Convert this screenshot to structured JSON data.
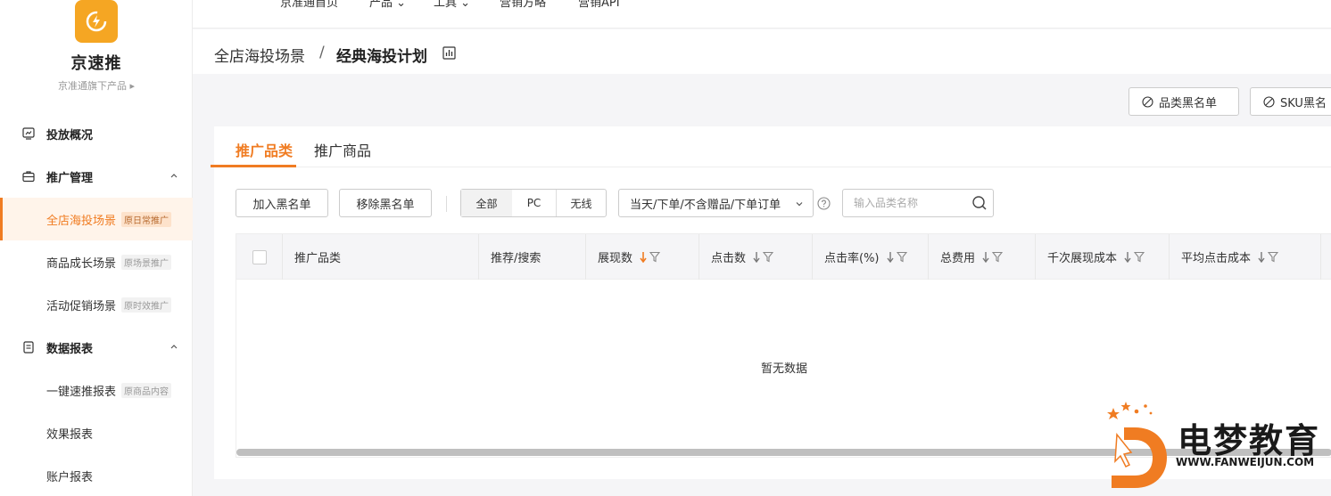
{
  "sidebar": {
    "brand": "京速推",
    "brand_sub": "京准通旗下产品 ▸",
    "groups": {
      "overview": "投放概况",
      "promo_mgmt": "推广管理",
      "reports": "数据报表"
    },
    "items": [
      {
        "label": "全店海投场景",
        "tag": "原日常推广"
      },
      {
        "label": "商品成长场景",
        "tag": "原场景推广"
      },
      {
        "label": "活动促销场景",
        "tag": "原时效推广"
      },
      {
        "label": "一键速推报表",
        "tag": "原商品内容"
      },
      {
        "label": "效果报表",
        "tag": ""
      },
      {
        "label": "账户报表",
        "tag": ""
      }
    ]
  },
  "topnav": [
    "京准通首页",
    "产品",
    "工具",
    "营销方略",
    "营销API"
  ],
  "breadcrumb": {
    "parent": "全店海投场景",
    "separator": "/",
    "current": "经典海投计划"
  },
  "actions": {
    "category_blacklist": "品类黑名单",
    "sku_blacklist": "SKU黑名"
  },
  "tabs": [
    "推广品类",
    "推广商品"
  ],
  "toolbar": {
    "add_blacklist": "加入黑名单",
    "remove_blacklist": "移除黑名单",
    "segments": [
      "全部",
      "PC",
      "无线"
    ],
    "date_select": "当天/下单/不含赠品/下单订单",
    "search_placeholder": "输入品类名称"
  },
  "table": {
    "columns": [
      "推广品类",
      "推荐/搜索",
      "展现数",
      "点击数",
      "点击率(%)",
      "总费用",
      "千次展现成本",
      "平均点击成本"
    ],
    "empty_text": "暂无数据"
  },
  "watermark": {
    "title": "电梦教育",
    "url": "WWW.FANWEIJUN.COM"
  },
  "colors": {
    "accent": "#f07c22",
    "logo": "#f5a623"
  }
}
